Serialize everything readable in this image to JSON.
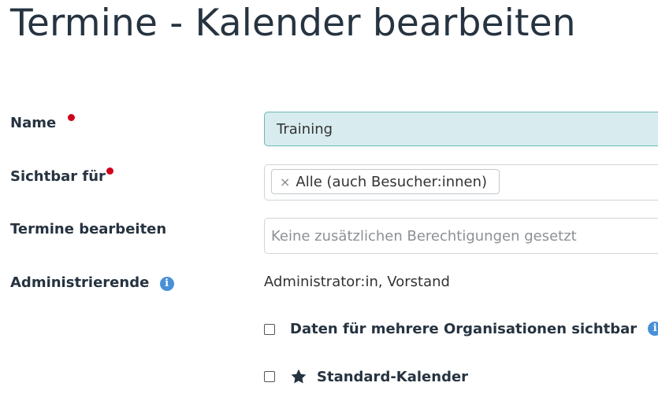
{
  "page": {
    "title": "Termine - Kalender bearbeiten"
  },
  "form": {
    "name": {
      "label": "Name",
      "value": "Training"
    },
    "visible_for": {
      "label": "Sichtbar für",
      "tags": [
        "Alle (auch Besucher:innen)"
      ],
      "remove_symbol": "×"
    },
    "edit_events": {
      "label": "Termine bearbeiten",
      "placeholder": "Keine zusätzlichen Berechtigungen gesetzt"
    },
    "administrators": {
      "label": "Administrierende",
      "value": "Administrator:in, Vorstand"
    },
    "multi_org": {
      "label": "Daten für mehrere Organisationen sichtbar",
      "checked": false
    },
    "default_calendar": {
      "label": "Standard-Kalender",
      "checked": false,
      "icon": "star-icon"
    }
  },
  "icons": {
    "info": "i"
  },
  "colors": {
    "required": "#d0021b",
    "info": "#4a90d9",
    "input_highlight": "#d8ecef",
    "heading": "#263340"
  }
}
